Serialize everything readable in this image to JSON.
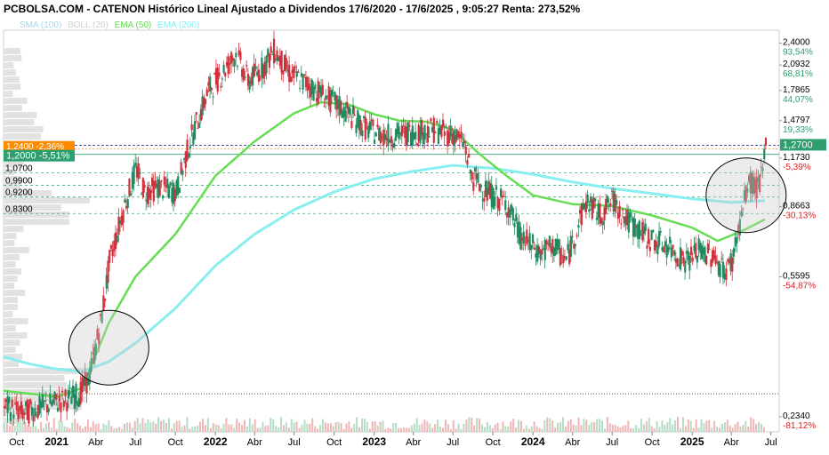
{
  "header": {
    "title": "PCBOLSA.COM - CATENON Histórico Lineal Ajustado a Dividendos 17/6/2020 - 17/6/2025 , 9:05:27 Renta: 273,52%"
  },
  "legend": [
    {
      "label": "SMA (100)",
      "color": "#9fd8f5"
    },
    {
      "label": "BOLL (20)",
      "color": "#d0d0d0"
    },
    {
      "label": "EMA (50)",
      "color": "#66dd55"
    },
    {
      "label": "EMA (200)",
      "color": "#88eeee"
    }
  ],
  "chart_data": {
    "type": "candlestick",
    "title": "PCBOLSA.COM - CATENON Histórico Lineal Ajustado a Dividendos 17/6/2020 - 17/6/2025 , 9:05:27 Renta: 273,52%",
    "x_range": [
      "2020-09-01",
      "2025-07-20"
    ],
    "y_scale": "log",
    "ylim": [
      0.213,
      2.6
    ],
    "right_axis": [
      {
        "price": "2,4000",
        "pct": "93,54%"
      },
      {
        "price": "2,0932",
        "pct": "68,81%"
      },
      {
        "price": "1,7865",
        "pct": "44,07%"
      },
      {
        "price": "1,4797",
        "pct": "19,33%"
      },
      {
        "price": "1,1730",
        "pct": "-5,39%"
      },
      {
        "price": "0,8663",
        "pct": "-30,13%"
      },
      {
        "price": "0,5595",
        "pct": "-54,87%"
      },
      {
        "price": "0,2340",
        "pct": "-81,12%"
      }
    ],
    "x_ticks": [
      {
        "label": "Oct",
        "date": "2020-10-01",
        "bold": false
      },
      {
        "label": "2021",
        "date": "2021-01-01",
        "bold": true
      },
      {
        "label": "Abr",
        "date": "2021-04-01",
        "bold": false
      },
      {
        "label": "Jul",
        "date": "2021-07-01",
        "bold": false
      },
      {
        "label": "Oct",
        "date": "2021-10-01",
        "bold": false
      },
      {
        "label": "2022",
        "date": "2022-01-01",
        "bold": true
      },
      {
        "label": "Abr",
        "date": "2022-04-01",
        "bold": false
      },
      {
        "label": "Jul",
        "date": "2022-07-01",
        "bold": false
      },
      {
        "label": "Oct",
        "date": "2022-10-01",
        "bold": false
      },
      {
        "label": "2023",
        "date": "2023-01-01",
        "bold": true
      },
      {
        "label": "Abr",
        "date": "2023-04-01",
        "bold": false
      },
      {
        "label": "Jul",
        "date": "2023-07-01",
        "bold": false
      },
      {
        "label": "Oct",
        "date": "2023-10-01",
        "bold": false
      },
      {
        "label": "2024",
        "date": "2024-01-01",
        "bold": true
      },
      {
        "label": "Abr",
        "date": "2024-04-01",
        "bold": false
      },
      {
        "label": "Jul",
        "date": "2024-07-01",
        "bold": false
      },
      {
        "label": "Oct",
        "date": "2024-10-01",
        "bold": false
      },
      {
        "label": "2025",
        "date": "2025-01-01",
        "bold": true
      },
      {
        "label": "Abr",
        "date": "2025-04-01",
        "bold": false
      },
      {
        "label": "Jul",
        "date": "2025-07-01",
        "bold": false
      }
    ],
    "left_levels": [
      {
        "label": "1,0700",
        "value": 1.07
      },
      {
        "label": "0,9900",
        "value": 0.99
      },
      {
        "label": "0,9200",
        "value": 0.92
      },
      {
        "label": "0,8300",
        "value": 0.83
      }
    ],
    "price_tags": [
      {
        "label": "1,2400 -2,36%",
        "value": 1.24,
        "color": "#ff8c00"
      },
      {
        "label": "1,2000 -5,51%",
        "value": 1.2,
        "color": "#2e9e6e"
      },
      {
        "label": "1,2700",
        "value": 1.27,
        "color": "#2e9e6e"
      }
    ],
    "dotted_level": 0.27,
    "ema50": [
      [
        "2020-09-01",
        0.275
      ],
      [
        "2021-01-01",
        0.265
      ],
      [
        "2021-03-01",
        0.28
      ],
      [
        "2021-05-01",
        0.42
      ],
      [
        "2021-07-01",
        0.56
      ],
      [
        "2021-10-01",
        0.73
      ],
      [
        "2022-01-01",
        1.05
      ],
      [
        "2022-04-01",
        1.3
      ],
      [
        "2022-07-01",
        1.55
      ],
      [
        "2022-09-01",
        1.66
      ],
      [
        "2022-11-01",
        1.64
      ],
      [
        "2023-01-01",
        1.54
      ],
      [
        "2023-03-01",
        1.48
      ],
      [
        "2023-05-01",
        1.47
      ],
      [
        "2023-07-01",
        1.4
      ],
      [
        "2023-09-01",
        1.2
      ],
      [
        "2023-11-01",
        1.05
      ],
      [
        "2024-01-01",
        0.93
      ],
      [
        "2024-04-01",
        0.88
      ],
      [
        "2024-07-01",
        0.87
      ],
      [
        "2024-10-01",
        0.82
      ],
      [
        "2025-01-01",
        0.76
      ],
      [
        "2025-03-01",
        0.7
      ],
      [
        "2025-05-01",
        0.75
      ],
      [
        "2025-06-17",
        0.8
      ]
    ],
    "ema200": [
      [
        "2020-09-01",
        0.34
      ],
      [
        "2020-11-01",
        0.325
      ],
      [
        "2021-01-01",
        0.315
      ],
      [
        "2021-03-01",
        0.31
      ],
      [
        "2021-05-01",
        0.33
      ],
      [
        "2021-07-01",
        0.37
      ],
      [
        "2021-10-01",
        0.46
      ],
      [
        "2022-01-01",
        0.6
      ],
      [
        "2022-04-01",
        0.73
      ],
      [
        "2022-07-01",
        0.85
      ],
      [
        "2022-10-01",
        0.95
      ],
      [
        "2023-01-01",
        1.03
      ],
      [
        "2023-04-01",
        1.08
      ],
      [
        "2023-07-01",
        1.12
      ],
      [
        "2023-10-01",
        1.1
      ],
      [
        "2024-01-01",
        1.06
      ],
      [
        "2024-04-01",
        1.01
      ],
      [
        "2024-07-01",
        0.97
      ],
      [
        "2024-10-01",
        0.94
      ],
      [
        "2025-01-01",
        0.91
      ],
      [
        "2025-04-01",
        0.89
      ],
      [
        "2025-06-17",
        0.9
      ]
    ],
    "price_path": [
      [
        "2020-09-01",
        0.25
      ],
      [
        "2020-10-15",
        0.24
      ],
      [
        "2020-12-01",
        0.25
      ],
      [
        "2021-01-15",
        0.26
      ],
      [
        "2021-02-20",
        0.27
      ],
      [
        "2021-03-15",
        0.3
      ],
      [
        "2021-04-10",
        0.42
      ],
      [
        "2021-05-01",
        0.62
      ],
      [
        "2021-06-01",
        0.85
      ],
      [
        "2021-07-01",
        1.1
      ],
      [
        "2021-07-20",
        0.95
      ],
      [
        "2021-08-20",
        0.98
      ],
      [
        "2021-10-01",
        0.95
      ],
      [
        "2021-11-01",
        1.3
      ],
      [
        "2021-12-15",
        1.8
      ],
      [
        "2022-01-15",
        2.0
      ],
      [
        "2022-02-15",
        2.25
      ],
      [
        "2022-03-15",
        1.9
      ],
      [
        "2022-04-15",
        2.05
      ],
      [
        "2022-05-15",
        2.3
      ],
      [
        "2022-06-15",
        2.0
      ],
      [
        "2022-08-01",
        1.85
      ],
      [
        "2022-09-01",
        1.75
      ],
      [
        "2022-10-01",
        1.65
      ],
      [
        "2022-11-15",
        1.5
      ],
      [
        "2022-12-15",
        1.4
      ],
      [
        "2023-02-01",
        1.35
      ],
      [
        "2023-04-01",
        1.38
      ],
      [
        "2023-05-15",
        1.4
      ],
      [
        "2023-07-01",
        1.36
      ],
      [
        "2023-07-25",
        1.28
      ],
      [
        "2023-08-10",
        1.05
      ],
      [
        "2023-09-15",
        0.95
      ],
      [
        "2023-11-01",
        0.88
      ],
      [
        "2023-12-01",
        0.72
      ],
      [
        "2024-01-15",
        0.65
      ],
      [
        "2024-02-15",
        0.68
      ],
      [
        "2024-03-15",
        0.62
      ],
      [
        "2024-05-01",
        0.9
      ],
      [
        "2024-06-01",
        0.82
      ],
      [
        "2024-07-01",
        0.9
      ],
      [
        "2024-08-01",
        0.8
      ],
      [
        "2024-09-15",
        0.72
      ],
      [
        "2024-11-01",
        0.68
      ],
      [
        "2024-12-15",
        0.62
      ],
      [
        "2025-01-15",
        0.66
      ],
      [
        "2025-02-15",
        0.64
      ],
      [
        "2025-03-15",
        0.58
      ],
      [
        "2025-04-01",
        0.62
      ],
      [
        "2025-04-20",
        0.8
      ],
      [
        "2025-05-10",
        1.02
      ],
      [
        "2025-05-25",
        0.97
      ],
      [
        "2025-06-10",
        1.05
      ],
      [
        "2025-06-17",
        1.27
      ]
    ],
    "highlight_circles": [
      {
        "date": "2021-05-01",
        "value": 0.36
      },
      {
        "date": "2025-05-05",
        "value": 0.93
      }
    ]
  }
}
